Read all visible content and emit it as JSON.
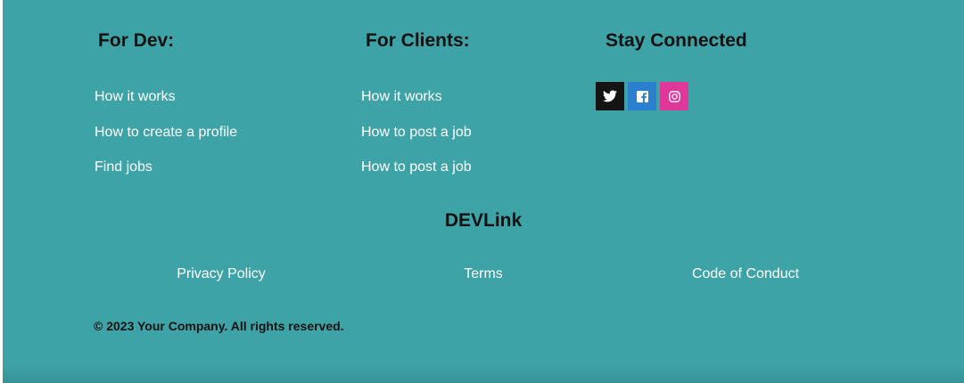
{
  "columns": {
    "dev": {
      "heading": "For Dev:",
      "links": [
        "How it works",
        "How to create a profile",
        "Find jobs"
      ]
    },
    "clients": {
      "heading": "For Clients:",
      "links": [
        "How it works",
        "How to post a job",
        "How to post a job"
      ]
    },
    "social": {
      "heading": "Stay Connected",
      "icons": [
        "twitter-icon",
        "facebook-icon",
        "instagram-icon"
      ],
      "colors": {
        "twitter": "#141414",
        "facebook": "#2a7fcf",
        "instagram": "#e0389a"
      }
    }
  },
  "brand": "DEVLink",
  "bottom_links": [
    "Privacy Policy",
    "Terms",
    "Code of Conduct"
  ],
  "copyright": "© 2023 Your Company. All rights reserved.",
  "colors": {
    "footer_background": "#3ea3a7",
    "heading_text": "#111111",
    "link_text": "#ffffff"
  }
}
